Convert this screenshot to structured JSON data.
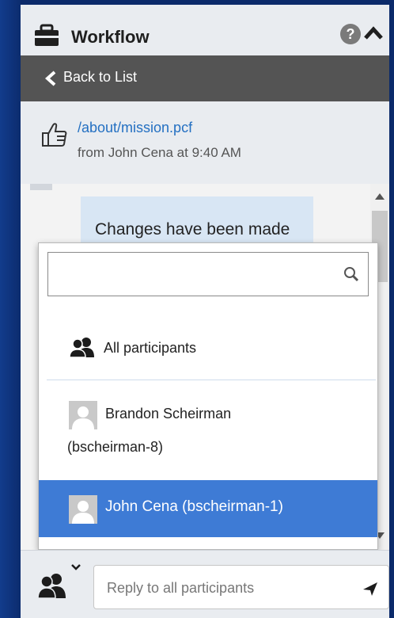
{
  "panel": {
    "title": "Workflow",
    "help_glyph": "?",
    "icons": {
      "title": "briefcase-icon",
      "help": "question-circle-icon",
      "collapse": "caret-up-icon"
    }
  },
  "nav": {
    "back_label": "Back to List",
    "icon": "chevron-left-icon"
  },
  "item": {
    "path": "/about/mission.pcf",
    "from": "from John Cena at 9:40 AM",
    "icon": "thumbs-up-icon"
  },
  "thread": {
    "message_visible": "Changes have been made"
  },
  "mention_dropdown": {
    "search_value": "",
    "search_icon": "search-icon",
    "options": [
      {
        "label": "All participants",
        "icon": "group-icon",
        "selected": false
      },
      {
        "label_line1": "Brandon Scheirman",
        "label_line2": "(bscheirman-8)",
        "icon": "avatar-placeholder",
        "selected": false
      },
      {
        "label": "John Cena (bscheirman-1)",
        "icon": "avatar-placeholder",
        "selected": true
      }
    ]
  },
  "reply": {
    "placeholder": "Reply to all participants",
    "value": "",
    "recipient_icon": "group-icon",
    "send_icon": "send-icon"
  },
  "colors": {
    "page_bg": "#0b2a6a",
    "header_dark": "#545454",
    "link": "#2470c2",
    "bubble": "#d8e6f4",
    "selected": "#3e7bd5"
  }
}
